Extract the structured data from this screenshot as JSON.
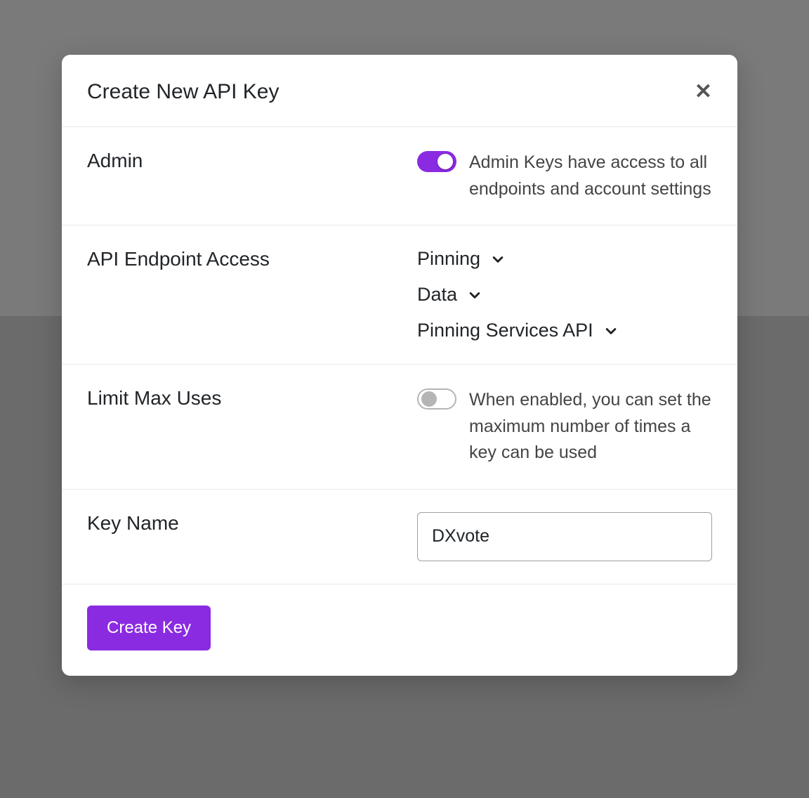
{
  "modal": {
    "title": "Create New API Key"
  },
  "admin": {
    "label": "Admin",
    "enabled": true,
    "help": "Admin Keys have access to all endpoints and account settings"
  },
  "endpoint_access": {
    "label": "API Endpoint Access",
    "groups": [
      {
        "label": "Pinning"
      },
      {
        "label": "Data"
      },
      {
        "label": "Pinning Services API"
      }
    ]
  },
  "limit_uses": {
    "label": "Limit Max Uses",
    "enabled": false,
    "help": "When enabled, you can set the maximum number of times a key can be used"
  },
  "key_name": {
    "label": "Key Name",
    "value": "DXvote"
  },
  "footer": {
    "create_label": "Create Key"
  }
}
